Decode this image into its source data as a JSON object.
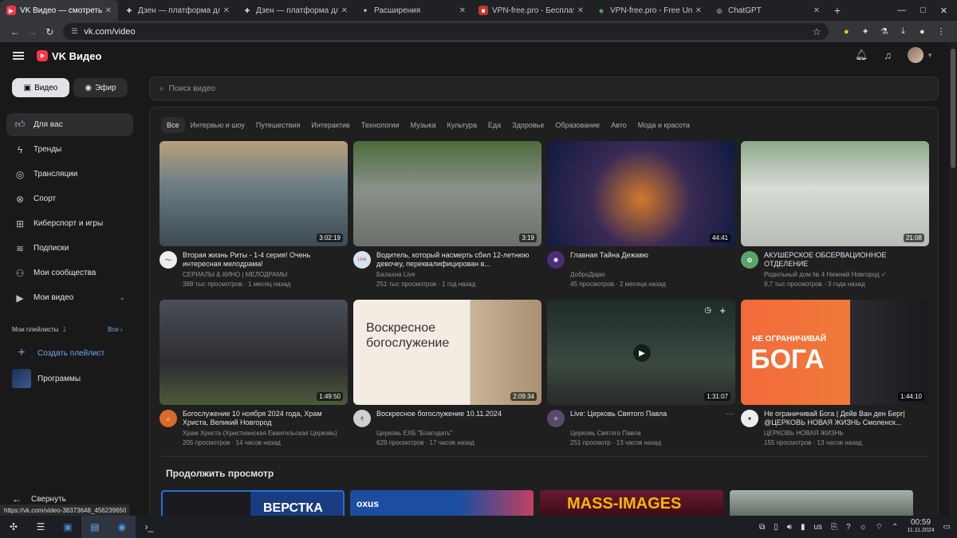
{
  "browser": {
    "tabs": [
      {
        "title": "VK Видео — смотреть онл",
        "favicon_color": "#ff3347",
        "active": true
      },
      {
        "title": "Дзен — платформа для пр",
        "favicon_color": "#2b2b2b",
        "active": false
      },
      {
        "title": "Дзен — платформа для пр",
        "favicon_color": "#2b2b2b",
        "active": false
      },
      {
        "title": "Расширения",
        "favicon_color": "#5f6368",
        "active": false
      },
      {
        "title": "VPN-free.pro - Бесплатный",
        "favicon_color": "#c0392b",
        "active": false
      },
      {
        "title": "VPN-free.pro - Free Unlimit",
        "favicon_color": "#2e7d32",
        "active": false
      },
      {
        "title": "ChatGPT",
        "favicon_color": "#444",
        "active": false
      }
    ],
    "url": "vk.com/video",
    "status_url": "https://vk.com/video-38373648_456239650"
  },
  "header": {
    "logo": "VK Видео"
  },
  "sidebar": {
    "segment": [
      {
        "label": "Видео"
      },
      {
        "label": "Эфир"
      }
    ],
    "items": [
      {
        "label": "Для вас",
        "icon": "thumb-up-icon"
      },
      {
        "label": "Тренды",
        "icon": "lightning-icon"
      },
      {
        "label": "Трансляции",
        "icon": "broadcast-icon"
      },
      {
        "label": "Спорт",
        "icon": "ball-icon"
      },
      {
        "label": "Киберспорт и игры",
        "icon": "gamepad-icon"
      },
      {
        "label": "Подписки",
        "icon": "subscriptions-icon"
      },
      {
        "label": "Мои сообщества",
        "icon": "communities-icon"
      },
      {
        "label": "Мои видео",
        "icon": "my-video-icon"
      }
    ],
    "playlists_title": "Мои плейлисты",
    "playlists_count": "1",
    "playlists_all": "Все",
    "create_playlist": "Создать плейлист",
    "playlist": "Программы",
    "collapse": "Свернуть"
  },
  "search": {
    "placeholder": "Поиск видео"
  },
  "chips": [
    "Все",
    "Интервью и шоу",
    "Путешествия",
    "Интерактив",
    "Технологии",
    "Музыка",
    "Культура",
    "Еда",
    "Здоровье",
    "Образование",
    "Авто",
    "Мода и красота"
  ],
  "videos": [
    {
      "title": "Вторая жизнь Риты - 1-4 серия! Очень интересная мелодрама!",
      "channel": "СЕРИАЛЫ & КИНО | МЕЛОДРАМЫ",
      "views": "388 тыс просмотров",
      "age": "1 месяц назад",
      "duration": "3:02:19",
      "thumb_bg": "#6f7f86",
      "avatar_bg": "#eeeeee"
    },
    {
      "title": "Водитель, который насмерть сбил 12-летнюю девочку, переквалифицирован в...",
      "channel": "Балахна Live",
      "views": "251 тыс просмотров",
      "age": "1 год назад",
      "duration": "3:19",
      "thumb_bg": "#77807a",
      "avatar_bg": "#d7e3f2"
    },
    {
      "title": "Главная Тайна Дежавю",
      "channel": "ДоброДарю",
      "views": "45 просмотров",
      "age": "2 месяца назад",
      "duration": "44:41",
      "thumb_bg": "#1d2a55",
      "avatar_bg": "#4a2e7a"
    },
    {
      "title": "АКУШЕРСКОЕ ОБСЕРВАЦИОННОЕ ОТДЕЛЕНИЕ",
      "channel": "Родильный дом № 4 Нижний Новгород ✓",
      "views": "9,7 тыс просмотров",
      "age": "3 года назад",
      "duration": "21:08",
      "thumb_bg": "#bfc9c2",
      "avatar_bg": "#5aa66a"
    },
    {
      "title": "Богослужение 10 ноября 2024 года, Храм Христа, Великий Новгород",
      "channel": "Храм Христа (Христианская Евангельская Церковь)",
      "views": "205 просмотров",
      "age": "14 часов назад",
      "duration": "1:49:50",
      "thumb_bg": "#3b3a40",
      "avatar_bg": "#d86a2a"
    },
    {
      "title": "Воскресное богослужение 10.11.2024",
      "channel": "Церковь ЕХБ \"Благодать\"",
      "views": "629 просмотров",
      "age": "17 часов назад",
      "duration": "2:09:34",
      "thumb_bg": "#e9e0d4",
      "avatar_bg": "#cfcfcf"
    },
    {
      "title": "Live: Церковь Святого Павла",
      "channel": "Церковь Святого Павла",
      "views": "251 просмотр",
      "age": "13 часов назад",
      "duration": "1:31:07",
      "thumb_bg": "#2a3a30",
      "avatar_bg": "#5a4a6a"
    },
    {
      "title": "Не ограничивай Бога | Дейв Ван ден Берг| @ЦЕРКОВЬ НОВАЯ ЖИЗНЬ Смоленск...",
      "channel": "ЦЕРКОВЬ НОВАЯ ЖИЗНЬ",
      "views": "155 просмотров",
      "age": "13 часов назад",
      "duration": "1:44:10",
      "thumb_bg": "#f07a3a",
      "avatar_bg": "#eeeeee"
    }
  ],
  "thumb_text": {
    "v6": "Воскресное богослужение",
    "v8a": "НЕ ОГРАНИЧИВАЙ",
    "v8b": "БОГА"
  },
  "continue": {
    "title": "Продолжить просмотр",
    "items": [
      {
        "text": "ВЕРСТКА",
        "bg": "#1a3c80"
      },
      {
        "text": "oxus",
        "bg": "#1b4ea0"
      },
      {
        "text": "MASS-IMAGES",
        "bg": "#8a1a3a"
      },
      {
        "text": "",
        "bg": "#7f8a86"
      }
    ]
  },
  "taskbar": {
    "lang": "us",
    "time": "00:59",
    "date": "11.11.2024"
  }
}
